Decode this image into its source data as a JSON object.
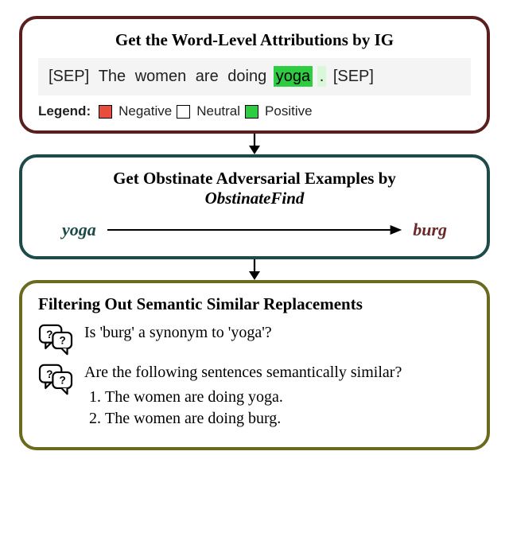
{
  "panel1": {
    "title": "Get the Word-Level Attributions by IG",
    "tokens": [
      "[SEP]",
      "The",
      "women",
      "are",
      "doing",
      "yoga",
      ".",
      "[SEP]"
    ],
    "highlight_index": 5,
    "faint_index": 6,
    "legend_label": "Legend:",
    "legend": [
      {
        "name": "Negative",
        "class": "sw-neg"
      },
      {
        "name": "Neutral",
        "class": "sw-neu"
      },
      {
        "name": "Positive",
        "class": "sw-pos"
      }
    ]
  },
  "panel2": {
    "title_pre": "Get Obstinate Adversarial Examples by",
    "title_emph": "ObstinateFind",
    "source_word": "yoga",
    "target_word": "burg"
  },
  "panel3": {
    "title": "Filtering Out Semantic Similar Replacements",
    "q1": "Is 'burg' a synonym to 'yoga'?",
    "q2_lead": "Are the following sentences semantically similar?",
    "q2_items": [
      "The women are doing yoga.",
      "The women are doing burg."
    ]
  },
  "icons": {
    "chat": "chat-bubble-question-icon",
    "arrow_down": "arrow-down-icon",
    "arrow_right": "arrow-right-icon"
  }
}
